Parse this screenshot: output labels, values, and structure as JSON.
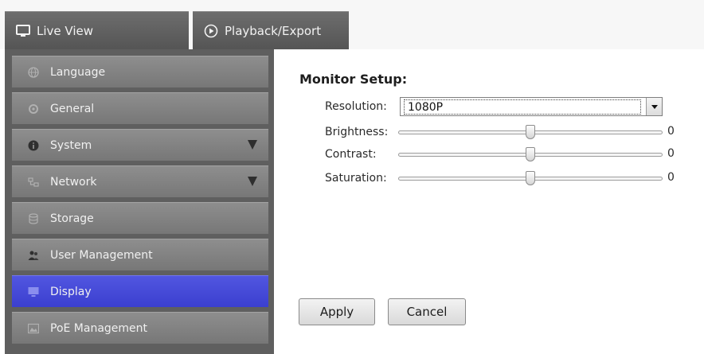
{
  "tabs": [
    {
      "label": "Live View",
      "icon": "monitor-icon"
    },
    {
      "label": "Playback/Export",
      "icon": "play-circle-icon"
    }
  ],
  "sidebar": {
    "items": [
      {
        "label": "Language",
        "icon": "globe-icon",
        "active": false,
        "expandable": false
      },
      {
        "label": "General",
        "icon": "settings-icon",
        "active": false,
        "expandable": false
      },
      {
        "label": "System",
        "icon": "info-icon",
        "active": false,
        "expandable": true
      },
      {
        "label": "Network",
        "icon": "network-icon",
        "active": false,
        "expandable": true
      },
      {
        "label": "Storage",
        "icon": "database-icon",
        "active": false,
        "expandable": false
      },
      {
        "label": "User Management",
        "icon": "users-icon",
        "active": false,
        "expandable": false
      },
      {
        "label": "Display",
        "icon": "monitor-icon",
        "active": true,
        "expandable": false
      },
      {
        "label": "PoE Management",
        "icon": "poe-icon",
        "active": false,
        "expandable": false
      }
    ],
    "active_color": "#4448d8"
  },
  "main": {
    "title": "Monitor Setup:",
    "resolution": {
      "label": "Resolution:",
      "value": "1080P"
    },
    "brightness": {
      "label": "Brightness:",
      "value": "0",
      "position": 0.5
    },
    "contrast": {
      "label": "Contrast:",
      "value": "0",
      "position": 0.5
    },
    "saturation": {
      "label": "Saturation:",
      "value": "0",
      "position": 0.5
    },
    "apply_label": "Apply",
    "cancel_label": "Cancel"
  }
}
